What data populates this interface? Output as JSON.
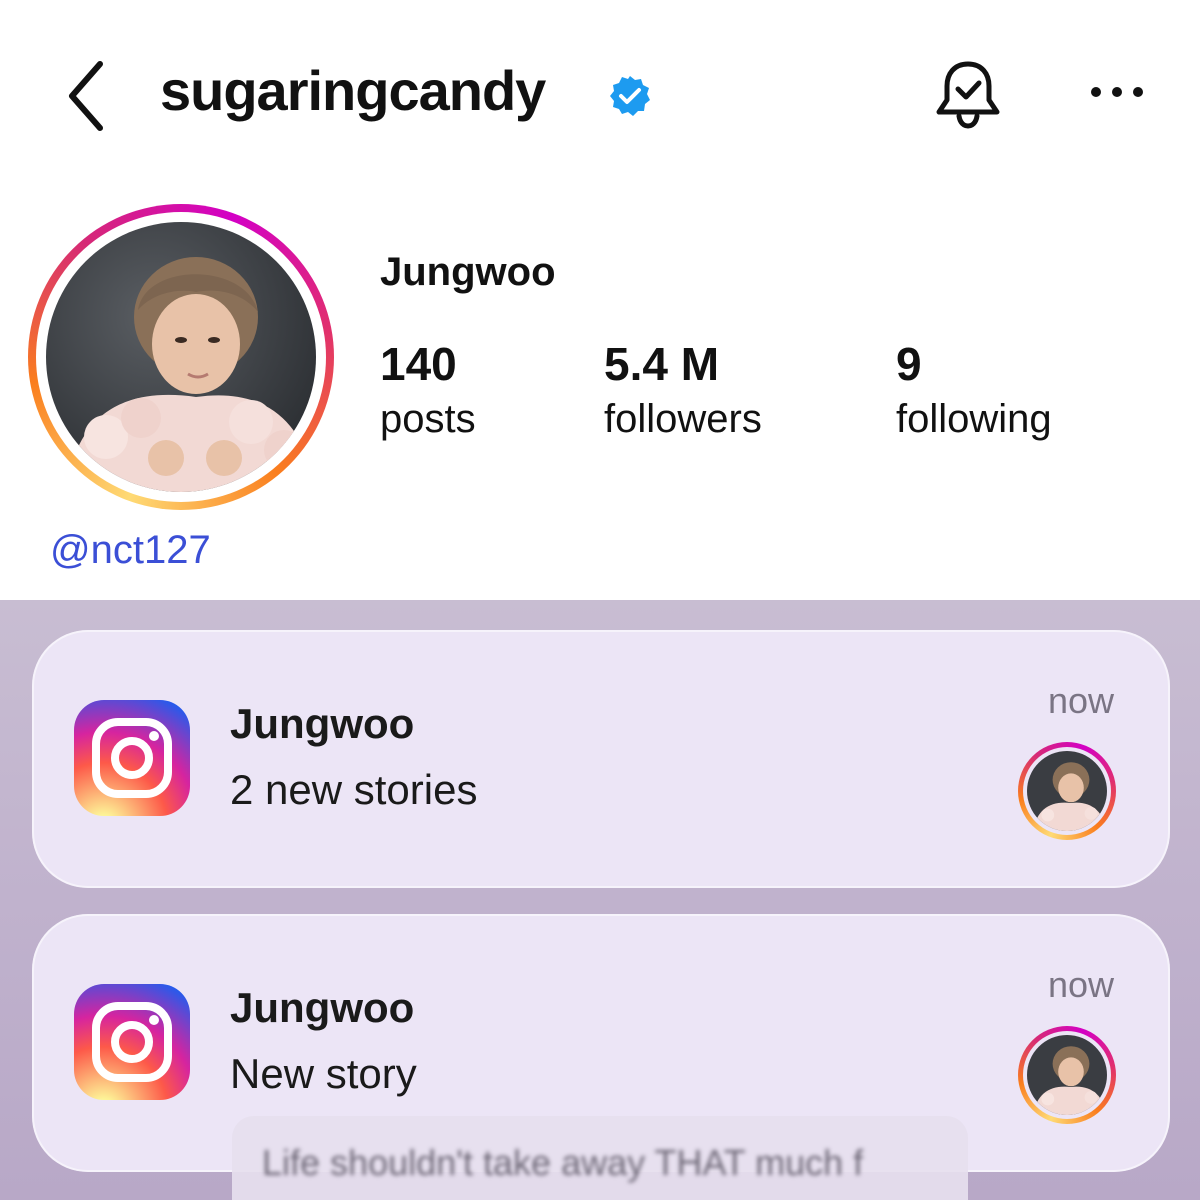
{
  "header": {
    "back_icon": "chevron-left-icon",
    "username": "sugaringcandy",
    "verified_icon": "verified-badge-icon",
    "bell_icon": "bell-check-icon",
    "more_icon": "more-horizontal-icon"
  },
  "profile": {
    "display_name": "Jungwoo",
    "mention": "@nct127",
    "stats": {
      "posts_count": "140",
      "posts_label": "posts",
      "followers_count": "5.4 M",
      "followers_label": "followers",
      "following_count": "9",
      "following_label": "following"
    }
  },
  "notifications": [
    {
      "app_icon": "instagram-icon",
      "title": "Jungwoo",
      "body": "2 new stories",
      "time": "now"
    },
    {
      "app_icon": "instagram-icon",
      "title": "Jungwoo",
      "body": "New story",
      "time": "now"
    }
  ],
  "preview": {
    "text": "Life shouldn't take away THAT much f"
  },
  "colors": {
    "verified_blue": "#1d9bf0",
    "mention_blue": "#3b4fd6",
    "notification_bg": "#ece5f6",
    "lockscreen_bg": "#c0b2cd"
  }
}
